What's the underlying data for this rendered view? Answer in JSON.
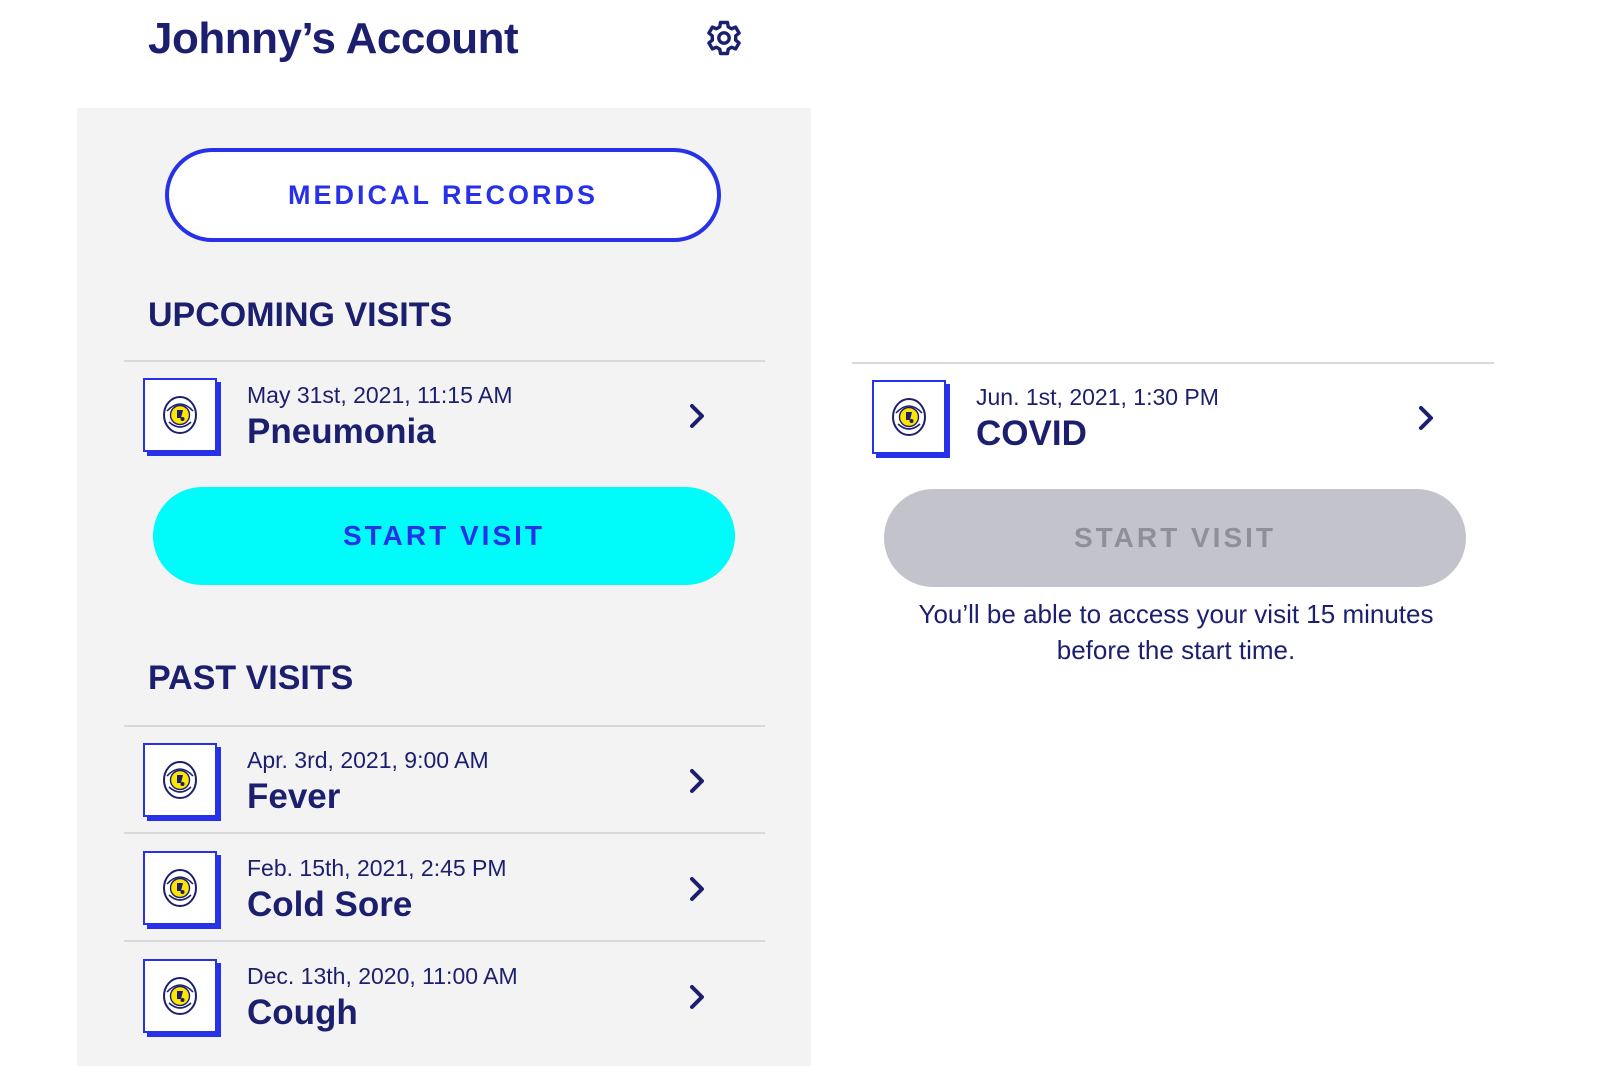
{
  "header": {
    "title": "Johnny’s Account",
    "settings_icon": "gear-icon"
  },
  "records_button": {
    "label": "MEDICAL RECORDS"
  },
  "upcoming": {
    "heading": "UPCOMING VISITS",
    "visits": [
      {
        "date": "May 31st, 2021, 11:15 AM",
        "name": "Pneumonia",
        "button": "START VISIT",
        "enabled": true
      },
      {
        "date": "Jun. 1st, 2021, 1:30 PM",
        "name": "COVID",
        "button": "START VISIT",
        "enabled": false,
        "note": "You’ll be able to access your visit 15 minutes before the start time."
      }
    ]
  },
  "past": {
    "heading": "PAST VISITS",
    "visits": [
      {
        "date": "Apr. 3rd, 2021, 9:00 AM",
        "name": "Fever"
      },
      {
        "date": "Feb. 15th, 2021, 2:45 PM",
        "name": "Cold Sore"
      },
      {
        "date": "Dec. 13th, 2020, 11:00 AM",
        "name": "Cough"
      }
    ]
  },
  "colors": {
    "navy": "#1b1f6e",
    "blue": "#2631e8",
    "cyan": "#00fbfb",
    "disabled": "#c3c3cb",
    "panel": "#f3f3f4"
  }
}
